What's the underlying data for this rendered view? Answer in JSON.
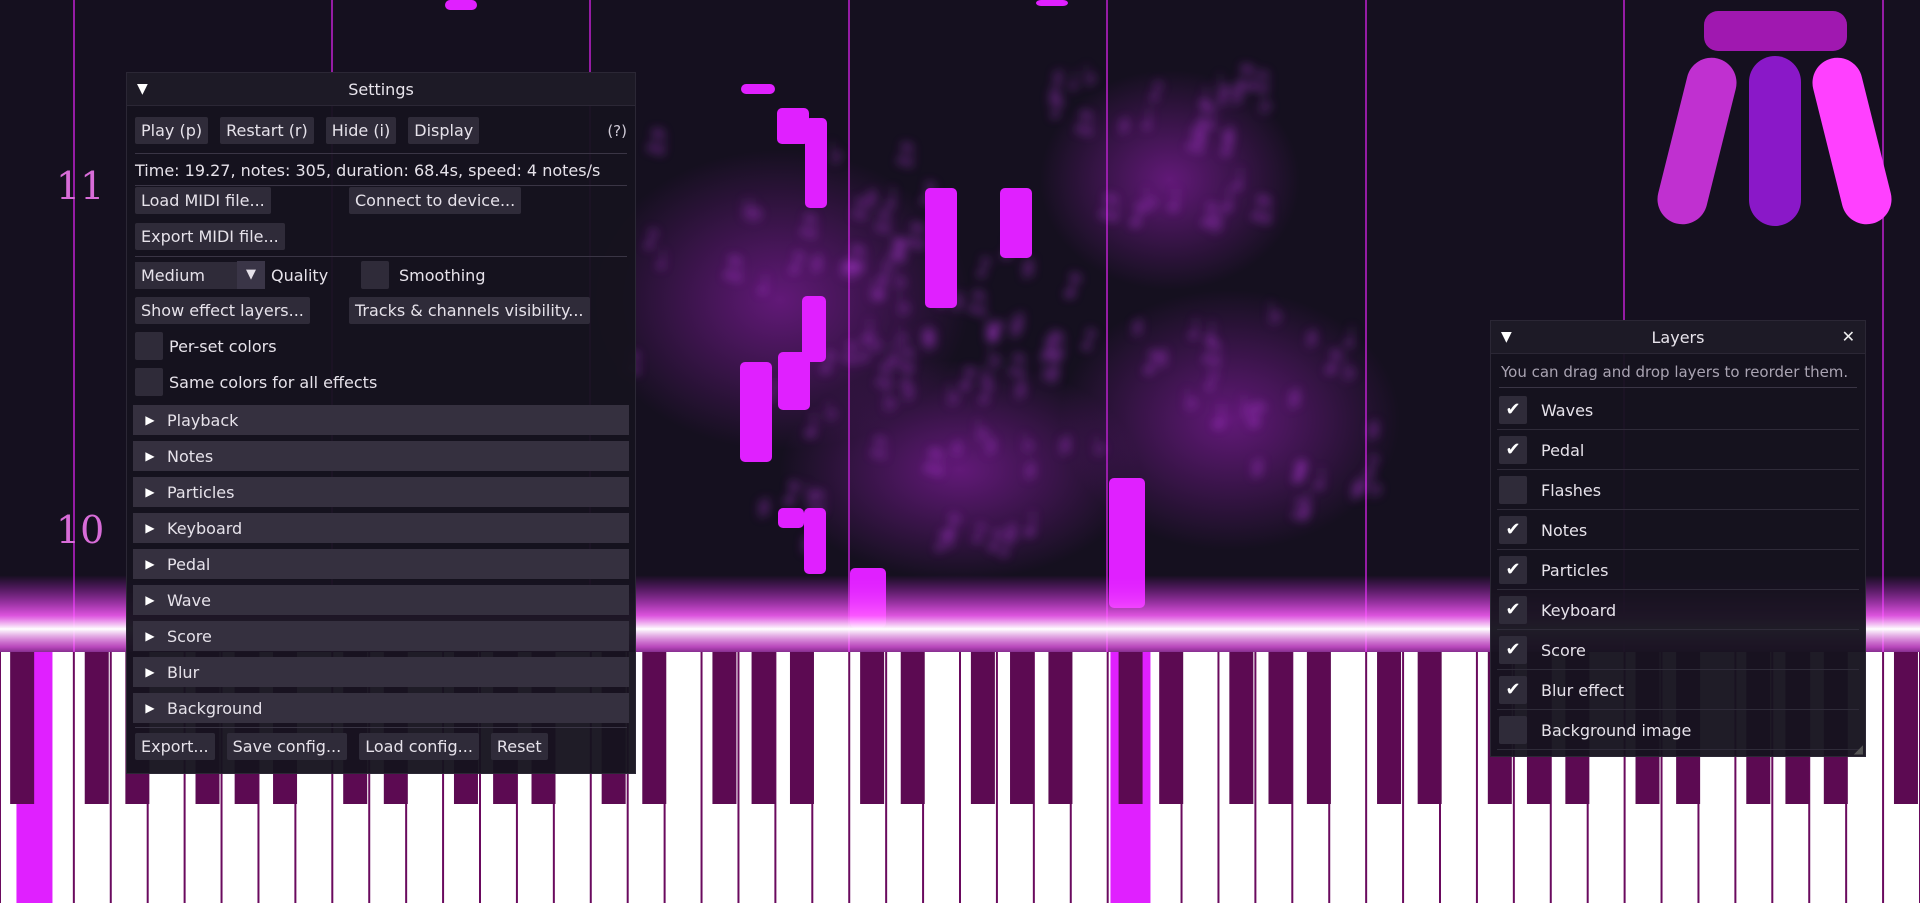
{
  "colors": {
    "accent": "#e020ff",
    "panel_bg": "#16131e",
    "button_bg": "#2f2b39",
    "section_bg": "#35303f",
    "background": "#15101f"
  },
  "score": {
    "measures": [
      "11",
      "10"
    ]
  },
  "settings": {
    "title": "Settings",
    "buttons": {
      "play": "Play (p)",
      "restart": "Restart (r)",
      "hide": "Hide (i)",
      "display": "Display",
      "help": "(?)"
    },
    "status": "Time: 19.27, notes: 305, duration: 68.4s, speed: 4 notes/s",
    "load_midi": "Load MIDI file...",
    "connect_device": "Connect to device...",
    "export_midi": "Export MIDI file...",
    "quality_value": "Medium",
    "quality_label": "Quality",
    "smoothing_label": "Smoothing",
    "show_effect_layers": "Show effect layers...",
    "tracks_visibility": "Tracks & channels visibility...",
    "per_set_colors": "Per-set colors",
    "same_colors": "Same colors for all effects",
    "sections": [
      "Playback",
      "Notes",
      "Particles",
      "Keyboard",
      "Pedal",
      "Wave",
      "Score",
      "Blur",
      "Background"
    ],
    "footer": {
      "export": "Export...",
      "save_config": "Save config...",
      "load_config": "Load config...",
      "reset": "Reset"
    }
  },
  "layers": {
    "title": "Layers",
    "hint": "You can drag and drop layers to reorder them.",
    "items": [
      {
        "label": "Waves",
        "checked": true
      },
      {
        "label": "Pedal",
        "checked": true
      },
      {
        "label": "Flashes",
        "checked": false
      },
      {
        "label": "Notes",
        "checked": true
      },
      {
        "label": "Particles",
        "checked": true
      },
      {
        "label": "Keyboard",
        "checked": true
      },
      {
        "label": "Score",
        "checked": true
      },
      {
        "label": "Blur effect",
        "checked": true
      },
      {
        "label": "Background image",
        "checked": false
      }
    ]
  }
}
